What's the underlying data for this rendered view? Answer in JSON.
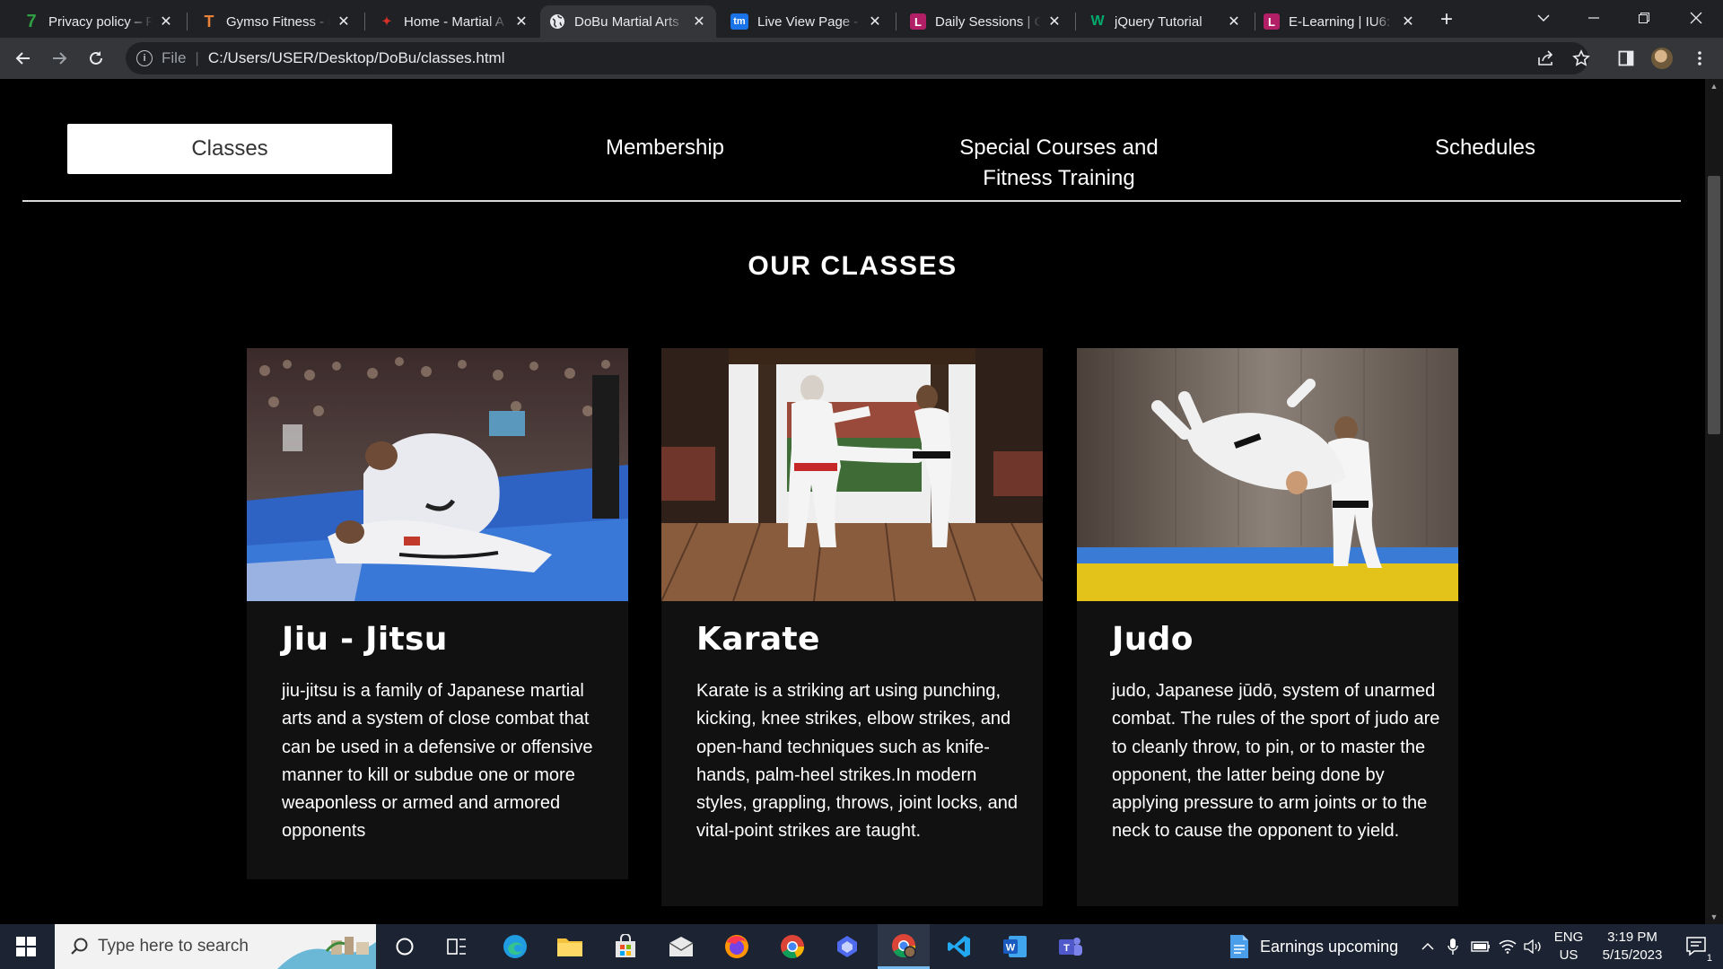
{
  "browser": {
    "tabs": [
      {
        "title": "Privacy policy – Pi",
        "icon": "seven-icon",
        "favicon_color": "#2ea043",
        "glyph": "7"
      },
      {
        "title": "Gymso Fitness - L",
        "icon": "t-icon",
        "favicon_color": "#e8823a",
        "glyph": "T"
      },
      {
        "title": "Home - Martial A",
        "icon": "martial-icon",
        "favicon_color": "#d93025",
        "glyph": "✦"
      },
      {
        "title": "DoBu Martial Arts",
        "icon": "globe-icon",
        "favicon_color": "#e8eaed",
        "glyph": "◍"
      },
      {
        "title": "Live View Page -",
        "icon": "tm-icon",
        "favicon_color": "#1a73e8",
        "glyph": "tm"
      },
      {
        "title": "Daily Sessions | C",
        "icon": "l-icon",
        "favicon_color": "#b21f66",
        "glyph": "L"
      },
      {
        "title": "jQuery Tutorial",
        "icon": "w3-icon",
        "favicon_color": "#04aa6d",
        "glyph": "W"
      },
      {
        "title": "E-Learning | IU6:",
        "icon": "l-icon",
        "favicon_color": "#b21f66",
        "glyph": "L"
      }
    ],
    "active_tab_index": 3,
    "address": {
      "scheme_label": "File",
      "url": "C:/Users/USER/Desktop/DoBu/classes.html"
    }
  },
  "site": {
    "nav": [
      {
        "label": "Classes",
        "active": true
      },
      {
        "label": "Membership",
        "active": false
      },
      {
        "label": "Special Courses and",
        "label2": "Fitness Training",
        "active": false
      },
      {
        "label": "Schedules",
        "active": false
      }
    ],
    "section_title": "OUR CLASSES",
    "classes": [
      {
        "name": "Jiu - Jitsu",
        "description": "jiu-jitsu is a family of Japanese martial arts and a system of close combat that can be used in a defensive or offensive manner to kill or subdue one or more weaponless or armed and armored opponents"
      },
      {
        "name": "Karate",
        "description": "Karate is a striking art using punching, kicking, knee strikes, elbow strikes, and open-hand techniques such as knife-hands, palm-heel strikes.In modern styles, grappling, throws, joint locks, and vital-point strikes are taught."
      },
      {
        "name": "Judo",
        "description": "judo, Japanese jūdō, system of unarmed combat. The rules of the sport of judo are to cleanly throw, to pin, or to master the opponent, the latter being done by applying pressure to arm joints or to the neck to cause the opponent to yield."
      }
    ]
  },
  "taskbar": {
    "search_placeholder": "Type here to search",
    "news_widget": "Earnings upcoming",
    "language": "ENG",
    "region": "US",
    "time": "3:19 PM",
    "date": "5/15/2023",
    "notification_count": "1"
  },
  "colors": {
    "page_bg": "#000000",
    "card_bg": "#111111",
    "tabstrip_bg": "#202124",
    "toolbar_bg": "#35363a",
    "taskbar_bg": "#1c2433"
  }
}
